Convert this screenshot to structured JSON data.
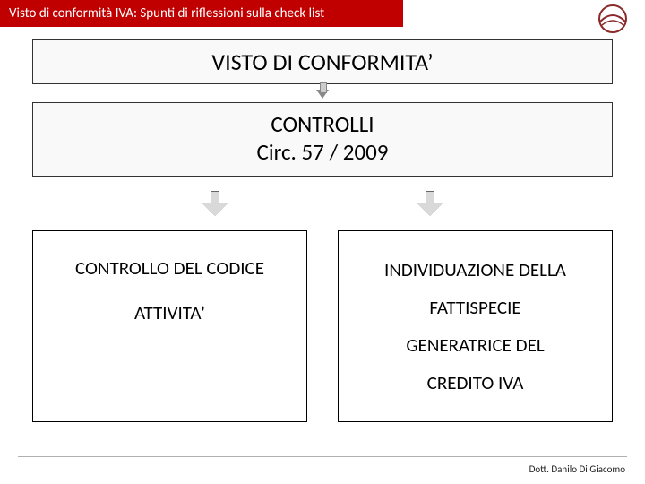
{
  "header": {
    "title": "Visto di conformità IVA: Spunti di riflessioni sulla check list"
  },
  "slide": {
    "main_title": "VISTO DI CONFORMITA’",
    "controls_line1": "CONTROLLI",
    "controls_line2": "Circ. 57 / 2009",
    "left_box_line1": "CONTROLLO DEL CODICE",
    "left_box_line2": "ATTIVITA’",
    "right_box_line1": "INDIVIDUAZIONE DELLA",
    "right_box_line2": "FATTISPECIE",
    "right_box_line3": "GENERATRICE DEL",
    "right_box_line4": "CREDITO IVA"
  },
  "footer": {
    "author": "Dott. Danilo Di Giacomo"
  }
}
